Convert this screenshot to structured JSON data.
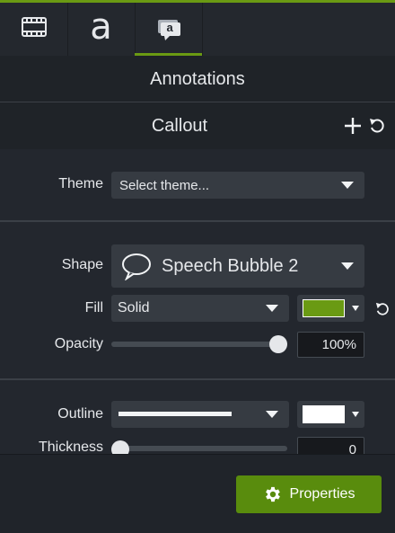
{
  "panel": {
    "section_title": "Annotations",
    "subsection_title": "Callout",
    "accent_color": "#6a9a13"
  },
  "tabs": [
    {
      "name": "media",
      "icon": "film-icon"
    },
    {
      "name": "text",
      "icon": "letter-a-icon",
      "glyph": "a"
    },
    {
      "name": "annotations",
      "icon": "callout-a-icon",
      "glyph": "a",
      "active": true
    }
  ],
  "theme": {
    "label": "Theme",
    "value": "Select theme..."
  },
  "shape": {
    "label": "Shape",
    "value": "Speech Bubble 2"
  },
  "fill": {
    "label": "Fill",
    "value": "Solid",
    "color": "#6a9a13"
  },
  "opacity": {
    "label": "Opacity",
    "value": "100%",
    "fraction": 1.0
  },
  "outline": {
    "label": "Outline",
    "color": "#ffffff"
  },
  "thickness": {
    "label": "Thickness",
    "value": "0",
    "fraction": 0.0
  },
  "footer": {
    "properties_label": "Properties"
  }
}
